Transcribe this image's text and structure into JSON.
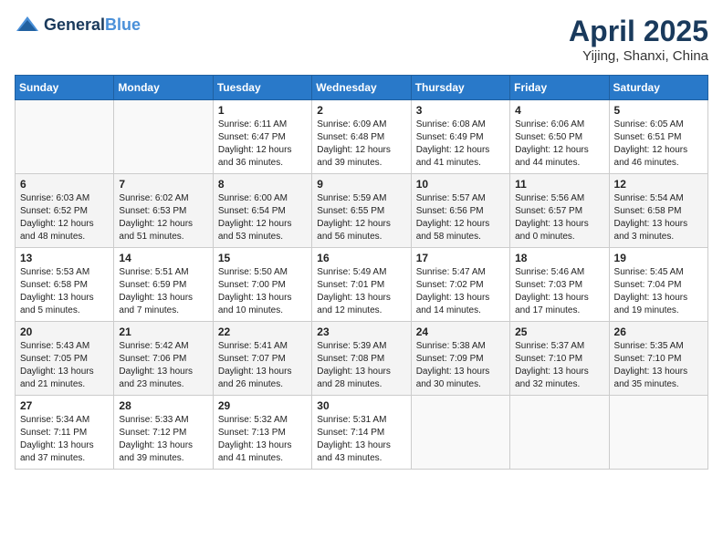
{
  "header": {
    "logo_general": "General",
    "logo_blue": "Blue",
    "month_year": "April 2025",
    "location": "Yijing, Shanxi, China"
  },
  "weekdays": [
    "Sunday",
    "Monday",
    "Tuesday",
    "Wednesday",
    "Thursday",
    "Friday",
    "Saturday"
  ],
  "weeks": [
    [
      {
        "day": "",
        "detail": ""
      },
      {
        "day": "",
        "detail": ""
      },
      {
        "day": "1",
        "detail": "Sunrise: 6:11 AM\nSunset: 6:47 PM\nDaylight: 12 hours\nand 36 minutes."
      },
      {
        "day": "2",
        "detail": "Sunrise: 6:09 AM\nSunset: 6:48 PM\nDaylight: 12 hours\nand 39 minutes."
      },
      {
        "day": "3",
        "detail": "Sunrise: 6:08 AM\nSunset: 6:49 PM\nDaylight: 12 hours\nand 41 minutes."
      },
      {
        "day": "4",
        "detail": "Sunrise: 6:06 AM\nSunset: 6:50 PM\nDaylight: 12 hours\nand 44 minutes."
      },
      {
        "day": "5",
        "detail": "Sunrise: 6:05 AM\nSunset: 6:51 PM\nDaylight: 12 hours\nand 46 minutes."
      }
    ],
    [
      {
        "day": "6",
        "detail": "Sunrise: 6:03 AM\nSunset: 6:52 PM\nDaylight: 12 hours\nand 48 minutes."
      },
      {
        "day": "7",
        "detail": "Sunrise: 6:02 AM\nSunset: 6:53 PM\nDaylight: 12 hours\nand 51 minutes."
      },
      {
        "day": "8",
        "detail": "Sunrise: 6:00 AM\nSunset: 6:54 PM\nDaylight: 12 hours\nand 53 minutes."
      },
      {
        "day": "9",
        "detail": "Sunrise: 5:59 AM\nSunset: 6:55 PM\nDaylight: 12 hours\nand 56 minutes."
      },
      {
        "day": "10",
        "detail": "Sunrise: 5:57 AM\nSunset: 6:56 PM\nDaylight: 12 hours\nand 58 minutes."
      },
      {
        "day": "11",
        "detail": "Sunrise: 5:56 AM\nSunset: 6:57 PM\nDaylight: 13 hours\nand 0 minutes."
      },
      {
        "day": "12",
        "detail": "Sunrise: 5:54 AM\nSunset: 6:58 PM\nDaylight: 13 hours\nand 3 minutes."
      }
    ],
    [
      {
        "day": "13",
        "detail": "Sunrise: 5:53 AM\nSunset: 6:58 PM\nDaylight: 13 hours\nand 5 minutes."
      },
      {
        "day": "14",
        "detail": "Sunrise: 5:51 AM\nSunset: 6:59 PM\nDaylight: 13 hours\nand 7 minutes."
      },
      {
        "day": "15",
        "detail": "Sunrise: 5:50 AM\nSunset: 7:00 PM\nDaylight: 13 hours\nand 10 minutes."
      },
      {
        "day": "16",
        "detail": "Sunrise: 5:49 AM\nSunset: 7:01 PM\nDaylight: 13 hours\nand 12 minutes."
      },
      {
        "day": "17",
        "detail": "Sunrise: 5:47 AM\nSunset: 7:02 PM\nDaylight: 13 hours\nand 14 minutes."
      },
      {
        "day": "18",
        "detail": "Sunrise: 5:46 AM\nSunset: 7:03 PM\nDaylight: 13 hours\nand 17 minutes."
      },
      {
        "day": "19",
        "detail": "Sunrise: 5:45 AM\nSunset: 7:04 PM\nDaylight: 13 hours\nand 19 minutes."
      }
    ],
    [
      {
        "day": "20",
        "detail": "Sunrise: 5:43 AM\nSunset: 7:05 PM\nDaylight: 13 hours\nand 21 minutes."
      },
      {
        "day": "21",
        "detail": "Sunrise: 5:42 AM\nSunset: 7:06 PM\nDaylight: 13 hours\nand 23 minutes."
      },
      {
        "day": "22",
        "detail": "Sunrise: 5:41 AM\nSunset: 7:07 PM\nDaylight: 13 hours\nand 26 minutes."
      },
      {
        "day": "23",
        "detail": "Sunrise: 5:39 AM\nSunset: 7:08 PM\nDaylight: 13 hours\nand 28 minutes."
      },
      {
        "day": "24",
        "detail": "Sunrise: 5:38 AM\nSunset: 7:09 PM\nDaylight: 13 hours\nand 30 minutes."
      },
      {
        "day": "25",
        "detail": "Sunrise: 5:37 AM\nSunset: 7:10 PM\nDaylight: 13 hours\nand 32 minutes."
      },
      {
        "day": "26",
        "detail": "Sunrise: 5:35 AM\nSunset: 7:10 PM\nDaylight: 13 hours\nand 35 minutes."
      }
    ],
    [
      {
        "day": "27",
        "detail": "Sunrise: 5:34 AM\nSunset: 7:11 PM\nDaylight: 13 hours\nand 37 minutes."
      },
      {
        "day": "28",
        "detail": "Sunrise: 5:33 AM\nSunset: 7:12 PM\nDaylight: 13 hours\nand 39 minutes."
      },
      {
        "day": "29",
        "detail": "Sunrise: 5:32 AM\nSunset: 7:13 PM\nDaylight: 13 hours\nand 41 minutes."
      },
      {
        "day": "30",
        "detail": "Sunrise: 5:31 AM\nSunset: 7:14 PM\nDaylight: 13 hours\nand 43 minutes."
      },
      {
        "day": "",
        "detail": ""
      },
      {
        "day": "",
        "detail": ""
      },
      {
        "day": "",
        "detail": ""
      }
    ]
  ]
}
